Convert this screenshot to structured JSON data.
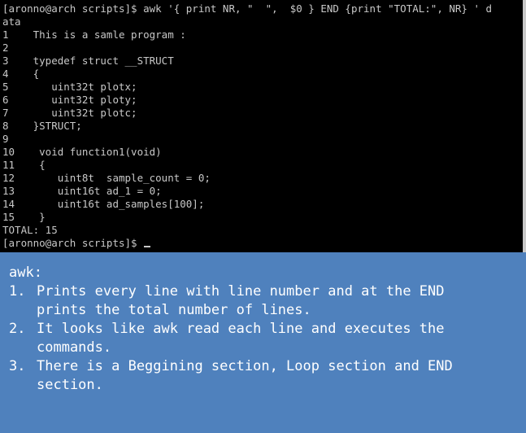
{
  "terminal": {
    "lines": [
      "[aronno@arch scripts]$ awk '{ print NR, \"  \",  $0 } END {print \"TOTAL:\", NR} ' d",
      "ata",
      "1    This is a samle program :",
      "2",
      "3    typedef struct __STRUCT",
      "4    {",
      "5       uint32t plotx;",
      "6       uint32t ploty;",
      "7       uint32t plotc;",
      "8    }STRUCT;",
      "9",
      "10    void function1(void)",
      "11    {",
      "12       uint8t  sample_count = 0;",
      "13       uint16t ad_1 = 0;",
      "14       uint16t ad_samples[100];",
      "15    }",
      "TOTAL: 15",
      "[aronno@arch scripts]$ "
    ]
  },
  "notes": {
    "title": "awk:",
    "items": [
      {
        "num": "1.",
        "text": "Prints every line with line number and at the END prints the total number of lines."
      },
      {
        "num": "2.",
        "text": "It looks like awk read each line and executes the commands."
      },
      {
        "num": "3.",
        "text": "There is a Beggining section, Loop section and END section."
      }
    ]
  },
  "colors": {
    "terminal_bg": "#000000",
    "terminal_fg": "#c8c8c8",
    "notes_bg": "#4f81bd",
    "notes_fg": "#ffffff"
  }
}
